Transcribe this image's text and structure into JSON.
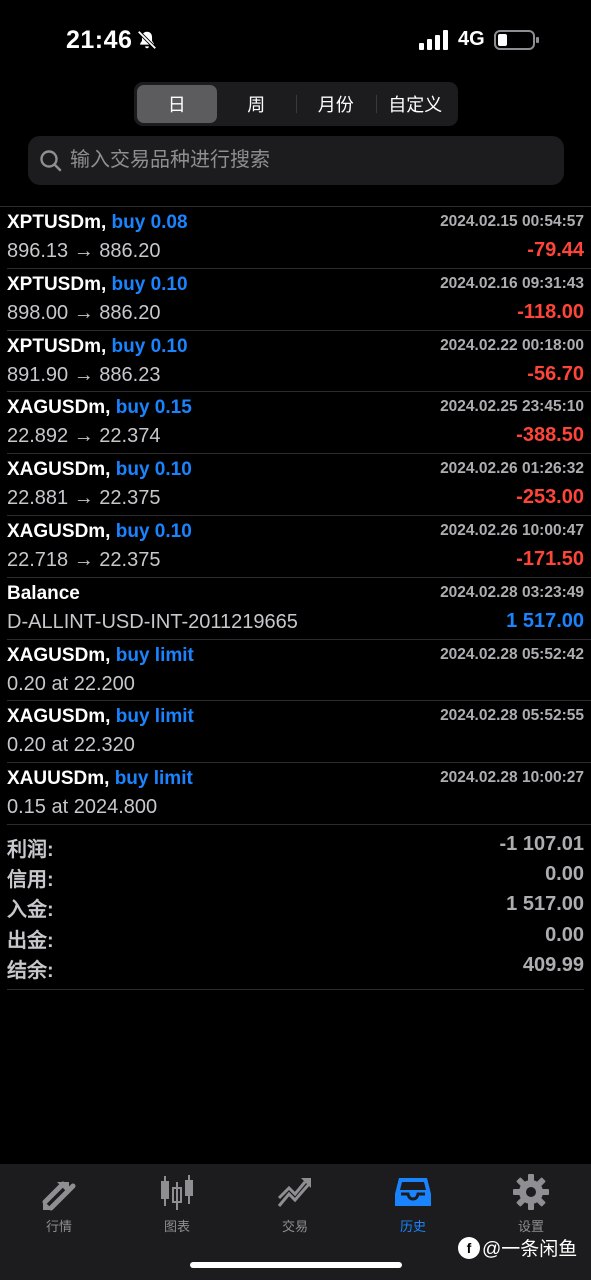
{
  "status": {
    "time": "21:46",
    "network": "4G"
  },
  "period_tabs": [
    "日",
    "周",
    "月份",
    "自定义"
  ],
  "search": {
    "placeholder": "输入交易品种进行搜索"
  },
  "history": [
    {
      "symbol": "XPTUSDm,",
      "action": "buy 0.08",
      "detail": "896.13 → 886.20",
      "datetime": "2024.02.15 00:54:57",
      "value": "-79.44",
      "value_type": "neg"
    },
    {
      "symbol": "XPTUSDm,",
      "action": "buy 0.10",
      "detail": "898.00 → 886.20",
      "datetime": "2024.02.16 09:31:43",
      "value": "-118.00",
      "value_type": "neg"
    },
    {
      "symbol": "XPTUSDm,",
      "action": "buy 0.10",
      "detail": "891.90 → 886.23",
      "datetime": "2024.02.22 00:18:00",
      "value": "-56.70",
      "value_type": "neg"
    },
    {
      "symbol": "XAGUSDm,",
      "action": "buy 0.15",
      "detail": "22.892 → 22.374",
      "datetime": "2024.02.25 23:45:10",
      "value": "-388.50",
      "value_type": "neg"
    },
    {
      "symbol": "XAGUSDm,",
      "action": "buy 0.10",
      "detail": "22.881 → 22.375",
      "datetime": "2024.02.26 01:26:32",
      "value": "-253.00",
      "value_type": "neg"
    },
    {
      "symbol": "XAGUSDm,",
      "action": "buy 0.10",
      "detail": "22.718 → 22.375",
      "datetime": "2024.02.26 10:00:47",
      "value": "-171.50",
      "value_type": "neg"
    },
    {
      "symbol": "Balance",
      "action": "",
      "detail": "D-ALLINT-USD-INT-2011219665",
      "datetime": "2024.02.28 03:23:49",
      "value": "1 517.00",
      "value_type": "pos"
    },
    {
      "symbol": "XAGUSDm,",
      "action": "buy limit",
      "detail": "0.20 at 22.200",
      "datetime": "2024.02.28 05:52:42",
      "value": "",
      "value_type": "none"
    },
    {
      "symbol": "XAGUSDm,",
      "action": "buy limit",
      "detail": "0.20 at 22.320",
      "datetime": "2024.02.28 05:52:55",
      "value": "",
      "value_type": "none"
    },
    {
      "symbol": "XAUUSDm,",
      "action": "buy limit",
      "detail": "0.15 at 2024.800",
      "datetime": "2024.02.28 10:00:27",
      "value": "",
      "value_type": "none"
    }
  ],
  "summary": [
    {
      "label": "利润:",
      "value": "-1 107.01"
    },
    {
      "label": "信用:",
      "value": "0.00"
    },
    {
      "label": "入金:",
      "value": "1 517.00"
    },
    {
      "label": "出金:",
      "value": "0.00"
    },
    {
      "label": "结余:",
      "value": "409.99"
    }
  ],
  "tab_bar": [
    {
      "label": "行情",
      "icon": "quotes-arrows-icon"
    },
    {
      "label": "图表",
      "icon": "candlestick-icon"
    },
    {
      "label": "交易",
      "icon": "trade-chart-icon"
    },
    {
      "label": "历史",
      "icon": "inbox-history-icon",
      "active": true
    },
    {
      "label": "设置",
      "icon": "gear-icon"
    }
  ],
  "watermark": "@一条闲鱼",
  "colors": {
    "accent": "#1a84ff",
    "negative": "#ff453a",
    "background": "#000000"
  }
}
